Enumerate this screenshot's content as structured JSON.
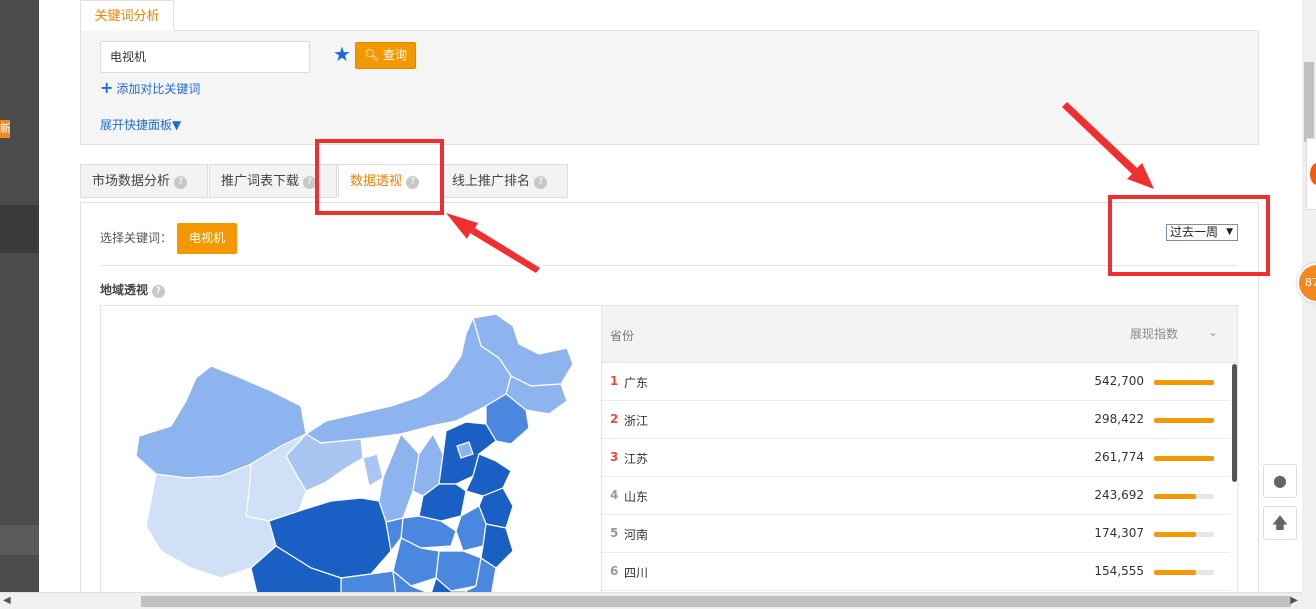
{
  "header": {
    "keyword_tab": "关键词分析"
  },
  "search": {
    "value": "电视机",
    "query_label": "查询",
    "add_compare": "添加对比关键词",
    "expand_panel": "展开快捷面板"
  },
  "tabs": [
    {
      "label": "市场数据分析",
      "help": "?"
    },
    {
      "label": "推广词表下载",
      "help": "?"
    },
    {
      "label": "数据透视",
      "help": "?"
    },
    {
      "label": "线上推广排名",
      "help": "?"
    }
  ],
  "filter": {
    "choose_label": "选择关键词：",
    "keyword_button": "电视机",
    "period": "过去一周"
  },
  "region": {
    "title": "地域透视",
    "help": "?"
  },
  "table": {
    "col_province": "省份",
    "col_index": "展现指数",
    "rows": [
      {
        "rank": "1",
        "province": "广东",
        "value": "542,700",
        "level": 1.0
      },
      {
        "rank": "2",
        "province": "浙江",
        "value": "298,422",
        "level": 1.0
      },
      {
        "rank": "3",
        "province": "江苏",
        "value": "261,774",
        "level": 1.0
      },
      {
        "rank": "4",
        "province": "山东",
        "value": "243,692",
        "level": 0.7
      },
      {
        "rank": "5",
        "province": "河南",
        "value": "174,307",
        "level": 0.7
      },
      {
        "rank": "6",
        "province": "四川",
        "value": "154,555",
        "level": 0.7
      }
    ]
  },
  "side": {
    "badge": "87"
  },
  "colors": {
    "accent": "#f39800",
    "link": "#1e6bd6",
    "annotation": "#f03030",
    "map_dark": "#1a5fc4",
    "map_light": "#cfe0f7"
  }
}
